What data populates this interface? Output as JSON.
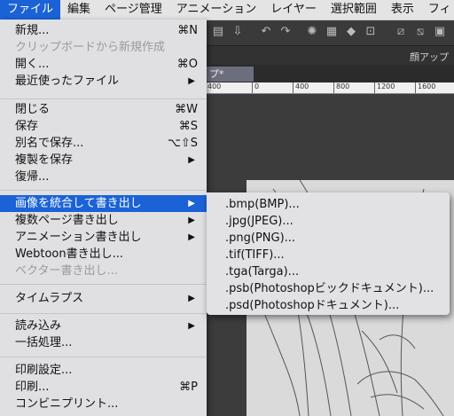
{
  "menubar": {
    "items": [
      "ファイル",
      "編集",
      "ページ管理",
      "アニメーション",
      "レイヤー",
      "選択範囲",
      "表示",
      "フィ"
    ],
    "active_index": 0
  },
  "app": {
    "tab_label": "プ*",
    "panel_title": "顔アップ",
    "ruler_labels": [
      "400",
      "0",
      "400",
      "800",
      "1200",
      "1600"
    ]
  },
  "file_menu": {
    "items": [
      {
        "label": "新規...",
        "shortcut": "⌘N"
      },
      {
        "label": "クリップボードから新規作成",
        "disabled": true
      },
      {
        "label": "開く...",
        "shortcut": "⌘O"
      },
      {
        "label": "最近使ったファイル",
        "submenu": true
      },
      {
        "label": "閉じる",
        "shortcut": "⌘W"
      },
      {
        "label": "保存",
        "shortcut": "⌘S"
      },
      {
        "label": "別名で保存...",
        "shortcut": "⌥⇧S"
      },
      {
        "label": "複製を保存",
        "submenu": true
      },
      {
        "label": "復帰..."
      },
      {
        "label": "画像を統合して書き出し",
        "submenu": true,
        "selected": true
      },
      {
        "label": "複数ページ書き出し",
        "submenu": true
      },
      {
        "label": "アニメーション書き出し",
        "submenu": true
      },
      {
        "label": "Webtoon書き出し..."
      },
      {
        "label": "ベクター書き出し...",
        "disabled": true
      },
      {
        "label": "タイムラプス",
        "submenu": true
      },
      {
        "label": "読み込み",
        "submenu": true
      },
      {
        "label": "一括処理..."
      },
      {
        "label": "印刷設定..."
      },
      {
        "label": "印刷...",
        "shortcut": "⌘P"
      },
      {
        "label": "コンビニプリント..."
      }
    ]
  },
  "export_submenu": {
    "items": [
      ".bmp(BMP)...",
      ".jpg(JPEG)...",
      ".png(PNG)...",
      ".tif(TIFF)...",
      ".tga(Targa)...",
      ".psb(Photoshopビックドキュメント)...",
      ".psd(Photoshopドキュメント)..."
    ]
  },
  "colors": {
    "accent": "#1a62d6",
    "menu_bg": "#e0e0e2",
    "canvas_bg": "#3c3c3c"
  }
}
